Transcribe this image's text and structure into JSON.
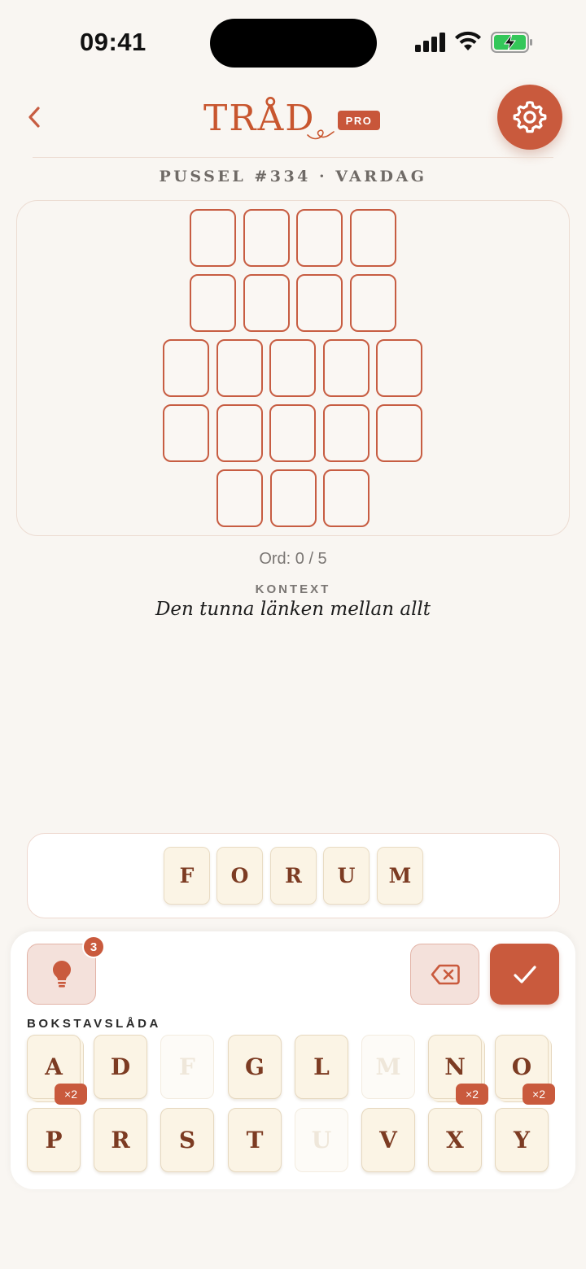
{
  "status_bar": {
    "time": "09:41"
  },
  "header": {
    "logo": "TRÅD",
    "badge": "PRO"
  },
  "puzzle": {
    "title": "PUSSEL #334 · VARDAG"
  },
  "board": {
    "rows": [
      4,
      4,
      5,
      5,
      3
    ]
  },
  "progress": {
    "word_count": "Ord: 0 / 5"
  },
  "context": {
    "label": "KONTEXT",
    "text": "Den tunna länken mellan allt"
  },
  "entry": {
    "letters": [
      "F",
      "O",
      "R",
      "U",
      "M"
    ]
  },
  "controls": {
    "hint_count": "3",
    "letter_box_label": "BOKSTAVSLÅDA"
  },
  "letter_box": {
    "row1": [
      {
        "letter": "A",
        "count": "×2",
        "used": false
      },
      {
        "letter": "D",
        "count": "",
        "used": false
      },
      {
        "letter": "F",
        "count": "",
        "used": true
      },
      {
        "letter": "G",
        "count": "",
        "used": false
      },
      {
        "letter": "L",
        "count": "",
        "used": false
      },
      {
        "letter": "M",
        "count": "",
        "used": true
      },
      {
        "letter": "N",
        "count": "×2",
        "used": false
      },
      {
        "letter": "O",
        "count": "×2",
        "used": false
      }
    ],
    "row2": [
      {
        "letter": "P",
        "count": "",
        "used": false
      },
      {
        "letter": "R",
        "count": "",
        "used": false
      },
      {
        "letter": "S",
        "count": "",
        "used": false
      },
      {
        "letter": "T",
        "count": "",
        "used": false
      },
      {
        "letter": "U",
        "count": "",
        "used": true
      },
      {
        "letter": "V",
        "count": "",
        "used": false
      },
      {
        "letter": "X",
        "count": "",
        "used": false
      },
      {
        "letter": "Y",
        "count": "",
        "used": false
      }
    ]
  },
  "colors": {
    "accent": "#c95a3d",
    "tile": "#fbf4e5",
    "tile_text": "#7c3b22",
    "background": "#f9f6f2"
  }
}
